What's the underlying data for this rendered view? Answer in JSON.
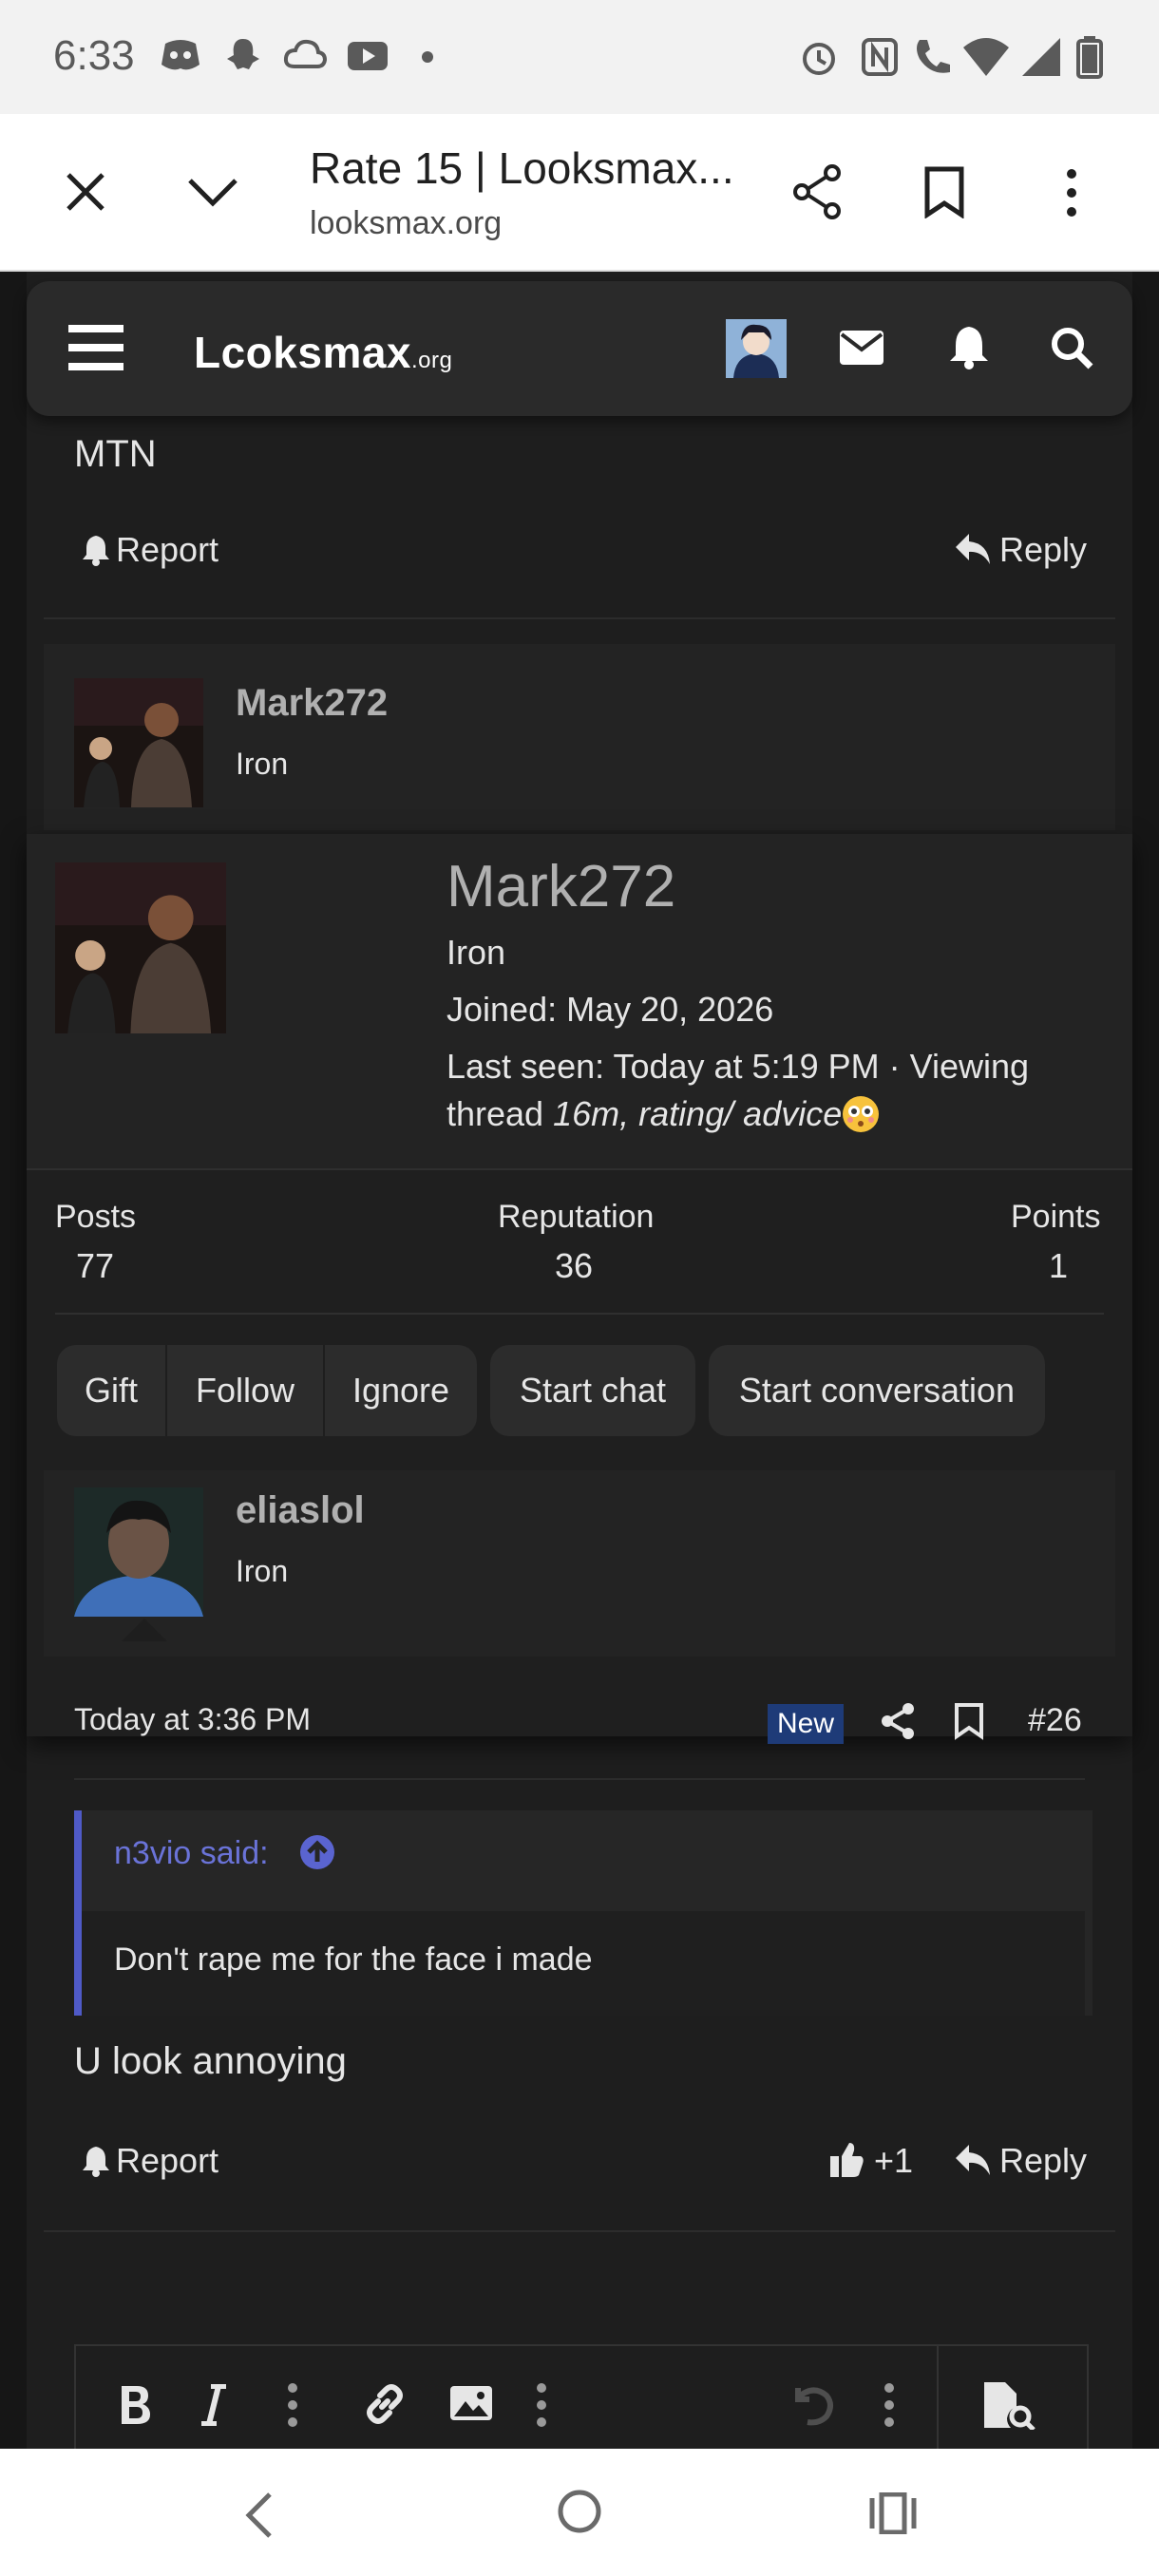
{
  "status_bar": {
    "time": "6:33",
    "left_icons": [
      "discord-icon",
      "snapchat-icon",
      "cloud-icon",
      "youtube-icon",
      "dot-icon"
    ],
    "right_icons": [
      "alarm-icon",
      "nfc-icon",
      "wifi-calling-icon",
      "wifi-icon",
      "signal-icon",
      "battery-icon"
    ]
  },
  "browser": {
    "title": "Rate 15 | Looksmax...",
    "url": "looksmax.org"
  },
  "site": {
    "logo_main": "Lcoksmax",
    "logo_suffix": ".org"
  },
  "prev_post": {
    "text": "MTN",
    "report_label": "Report",
    "reply_label": "Reply"
  },
  "post_user": {
    "username": "Mark272",
    "rank": "Iron"
  },
  "member_card": {
    "username": "Mark272",
    "rank": "Iron",
    "joined": "Joined: May 20, 2026",
    "last_seen_line1": "Last seen: Today at 5:19 PM · Viewing",
    "last_seen_prefix": "thread ",
    "viewing_thread": "16m, rating/ advice",
    "stats": {
      "posts_label": "Posts",
      "posts_value": "77",
      "reputation_label": "Reputation",
      "reputation_value": "36",
      "points_label": "Points",
      "points_value": "1"
    },
    "actions": {
      "gift": "Gift",
      "follow": "Follow",
      "ignore": "Ignore",
      "start_chat": "Start chat",
      "start_conversation": "Start conversation"
    }
  },
  "post": {
    "username": "eliaslol",
    "rank": "Iron",
    "timestamp": "Today at 3:36 PM",
    "new_badge": "New",
    "post_number": "#26",
    "quote_author": "n3vio said:",
    "quote_text": "Don't rape me for the face i made",
    "body": "U look annoying",
    "report_label": "Report",
    "like_count": "+1",
    "reply_label": "Reply"
  },
  "colors": {
    "background": "#161616",
    "panel": "#1e1e1e",
    "quote_accent": "#4f5ac7",
    "new_badge": "#1e3b78"
  }
}
